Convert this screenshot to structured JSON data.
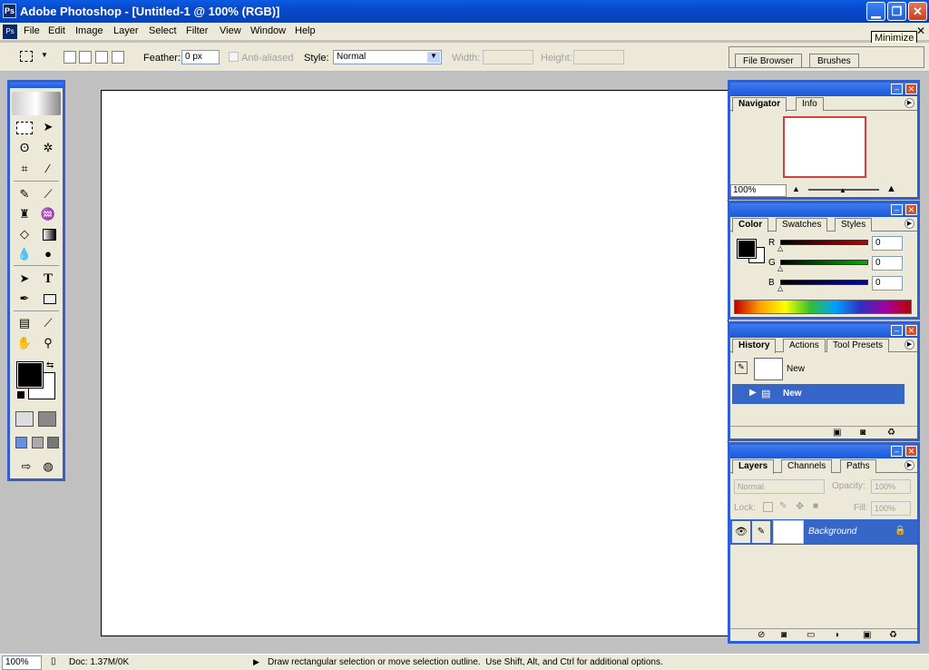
{
  "window": {
    "title": "Adobe Photoshop - [Untitled-1 @ 100% (RGB)]",
    "tooltip": "Minimize"
  },
  "menu": [
    "File",
    "Edit",
    "Image",
    "Layer",
    "Select",
    "Filter",
    "View",
    "Window",
    "Help"
  ],
  "options": {
    "feather_label": "Feather:",
    "feather_value": "0 px",
    "antialias_label": "Anti-aliased",
    "style_label": "Style:",
    "style_value": "Normal",
    "width_label": "Width:",
    "height_label": "Height:"
  },
  "palette_well": {
    "tabs": [
      "File Browser",
      "Brushes"
    ]
  },
  "navigator": {
    "tabs": [
      "Navigator",
      "Info"
    ],
    "zoom": "100%"
  },
  "color": {
    "tabs": [
      "Color",
      "Swatches",
      "Styles"
    ],
    "channels": [
      {
        "label": "R",
        "value": "0",
        "color": "#c00000"
      },
      {
        "label": "G",
        "value": "0",
        "color": "#00b000"
      },
      {
        "label": "B",
        "value": "0",
        "color": "#0000c0"
      }
    ]
  },
  "history": {
    "tabs": [
      "History",
      "Actions",
      "Tool Presets"
    ],
    "snapshot": "New",
    "state": "New"
  },
  "layers": {
    "tabs": [
      "Layers",
      "Channels",
      "Paths"
    ],
    "blend": "Normal",
    "opacity_label": "Opacity:",
    "opacity": "100%",
    "lock_label": "Lock:",
    "fill_label": "Fill:",
    "fill": "100%",
    "layer_name": "Background"
  },
  "status": {
    "zoom": "100%",
    "doc": "Doc: 1.37M/0K",
    "hint": "Draw rectangular selection or move selection outline.  Use Shift, Alt, and Ctrl for additional options."
  }
}
